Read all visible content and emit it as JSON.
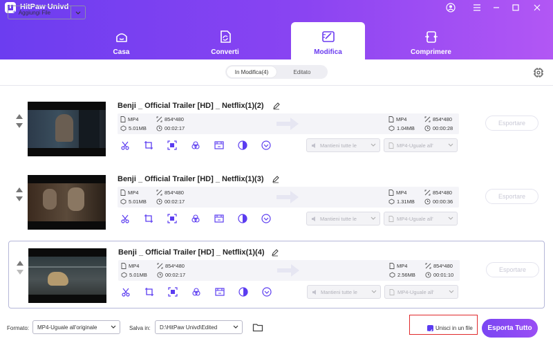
{
  "app": {
    "title": "HitPaw Univd"
  },
  "nav": [
    {
      "label": "Casa",
      "icon": "home-icon",
      "active": false
    },
    {
      "label": "Converti",
      "icon": "convert-icon",
      "active": false
    },
    {
      "label": "Modifica",
      "icon": "edit-icon",
      "active": true
    },
    {
      "label": "Comprimere",
      "icon": "compress-icon",
      "active": false
    }
  ],
  "toolbar": {
    "add_label": "Aggiungi File",
    "tabs": [
      {
        "label": "In Modifica(4)",
        "active": true
      },
      {
        "label": "Editato",
        "active": false
      }
    ]
  },
  "files": [
    {
      "name": "Benji _ Official Trailer [HD] _ Netflix(1)(2)",
      "src": {
        "format": "MP4",
        "resolution": "854*480",
        "size": "5.01MB",
        "duration": "00:02:17"
      },
      "out": {
        "format": "MP4",
        "resolution": "854*480",
        "size": "1.04MB",
        "duration": "00:00:28"
      },
      "audio_option": "Mantieni tutte le",
      "format_option": "MP4-Uguale all'",
      "export_label": "Esportare"
    },
    {
      "name": "Benji _ Official Trailer [HD] _ Netflix(1)(3)",
      "src": {
        "format": "MP4",
        "resolution": "854*480",
        "size": "5.01MB",
        "duration": "00:02:17"
      },
      "out": {
        "format": "MP4",
        "resolution": "854*480",
        "size": "1.31MB",
        "duration": "00:00:36"
      },
      "audio_option": "Mantieni tutte le",
      "format_option": "MP4-Uguale all'",
      "export_label": "Esportare"
    },
    {
      "name": "Benji _ Official Trailer [HD] _ Netflix(1)(4)",
      "src": {
        "format": "MP4",
        "resolution": "854*480",
        "size": "5.01MB",
        "duration": "00:02:17"
      },
      "out": {
        "format": "MP4",
        "resolution": "854*480",
        "size": "2.56MB",
        "duration": "00:01:10"
      },
      "audio_option": "Mantieni tutte le",
      "format_option": "MP4-Uguale all'",
      "export_label": "Esportare"
    }
  ],
  "footer": {
    "format_label": "Formato:",
    "format_value": "MP4-Uguale all'originale",
    "save_label": "Salva in:",
    "save_path": "D:\\HitPaw Univd\\Edited",
    "merge_label": "Unisci in un file",
    "merge_checked": true,
    "export_all_label": "Esporta Tutto"
  },
  "colors": {
    "accent": "#6a3bf0",
    "header_start": "#6c3df0",
    "header_end": "#b257f4",
    "highlight": "#e0282a"
  }
}
